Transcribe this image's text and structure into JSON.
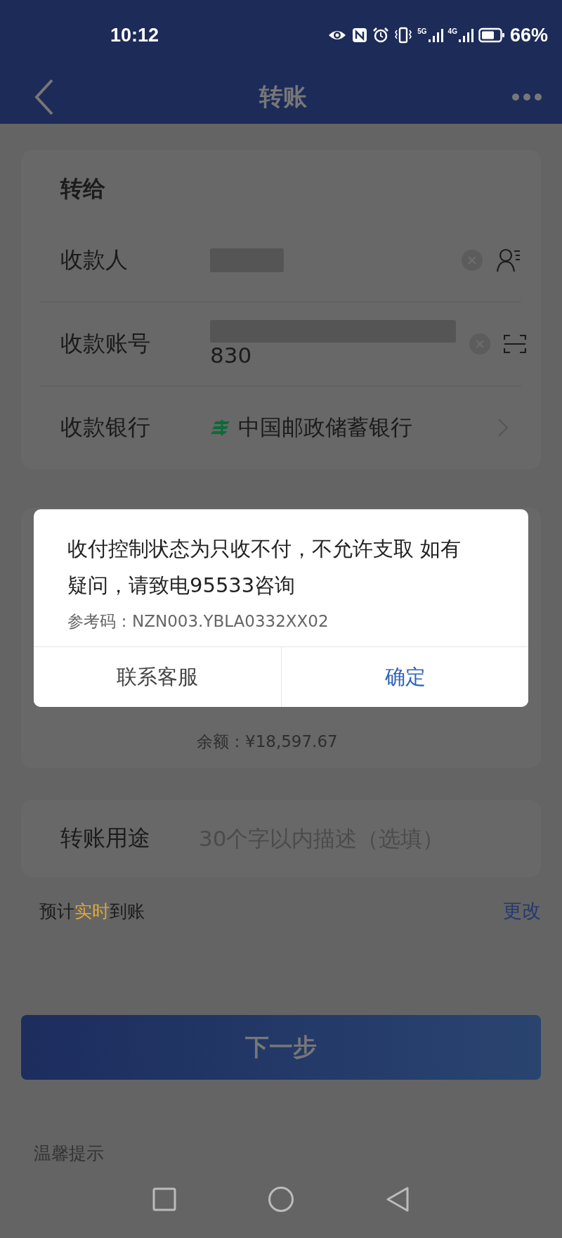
{
  "status_bar": {
    "time": "10:12",
    "networks": [
      {
        "label": "5G"
      },
      {
        "label": "4G"
      }
    ],
    "battery": "66%"
  },
  "nav": {
    "title": "转账"
  },
  "payee_card": {
    "title": "转给",
    "rows": [
      {
        "kind": "name",
        "label": "收款人",
        "value": ""
      },
      {
        "kind": "account",
        "label": "收款账号",
        "value": "830"
      },
      {
        "kind": "bank",
        "label": "收款银行",
        "value": "中国邮政储蓄银行"
      }
    ]
  },
  "payer_card": {
    "balance": "余额：¥18,597.67"
  },
  "purpose": {
    "label": "转账用途",
    "placeholder": "30个字以内描述（选填）"
  },
  "arrival": {
    "parts": [
      {
        "text": "预计",
        "kind": "plain"
      },
      {
        "text": "实时",
        "kind": "highlight"
      },
      {
        "text": "到账",
        "kind": "plain"
      }
    ],
    "change_link": "更改"
  },
  "next_button": "下一步",
  "tips_title": "温馨提示",
  "dialog": {
    "message": "收付控制状态为只收不付，不允许支取 如有疑问，请致电95533咨询",
    "reference": "参考码：NZN003.YBLA0332XX02",
    "buttons": [
      {
        "label": "联系客服",
        "kind": "secondary"
      },
      {
        "label": "确定",
        "kind": "primary"
      }
    ]
  }
}
